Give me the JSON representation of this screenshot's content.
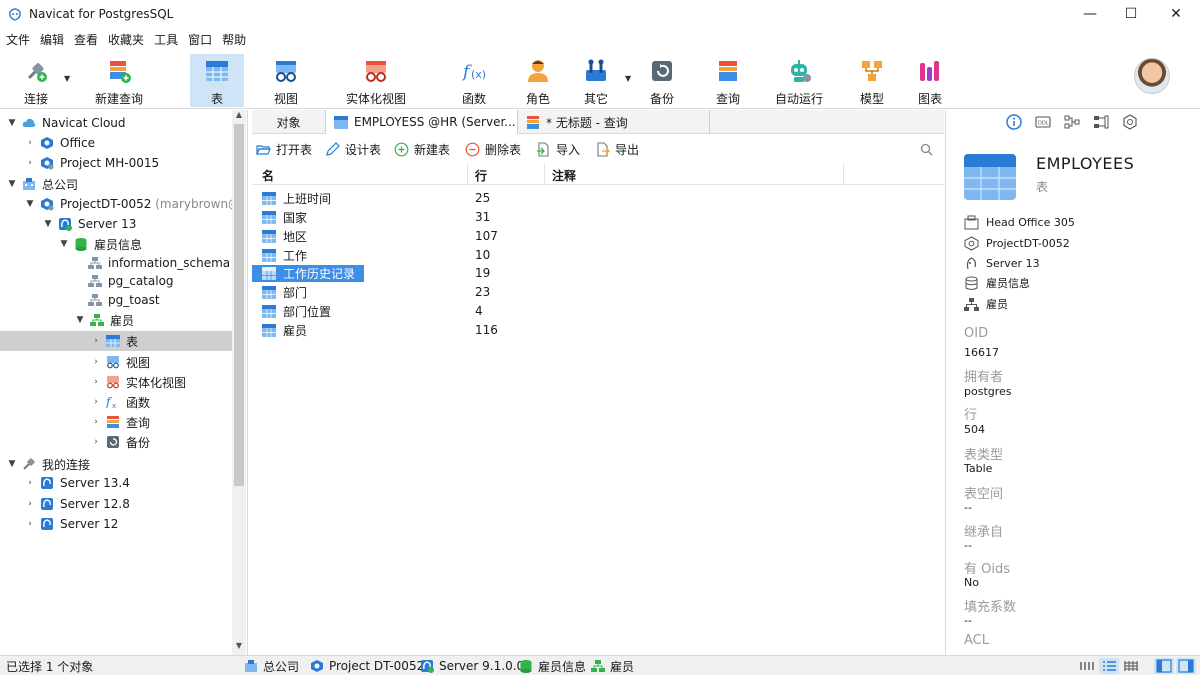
{
  "window": {
    "title": "Navicat for PostgresSQL",
    "minimize": "—",
    "maximize": "☐",
    "close": "✕"
  },
  "menu": [
    "文件",
    "编辑",
    "查看",
    "收藏夹",
    "工具",
    "窗口",
    "帮助"
  ],
  "toolbar": {
    "items": [
      {
        "label": "连接",
        "icon": "plug-icon"
      },
      {
        "label": "新建查询",
        "icon": "new-query-icon"
      },
      {
        "label": "表",
        "icon": "table-icon",
        "active": true
      },
      {
        "label": "视图",
        "icon": "view-icon"
      },
      {
        "label": "实体化视图",
        "icon": "materialized-view-icon"
      },
      {
        "label": "函数",
        "icon": "function-icon"
      },
      {
        "label": "角色",
        "icon": "role-icon"
      },
      {
        "label": "其它",
        "icon": "tools-icon"
      },
      {
        "label": "备份",
        "icon": "backup-icon"
      },
      {
        "label": "查询",
        "icon": "query-icon"
      },
      {
        "label": "自动运行",
        "icon": "robot-icon"
      },
      {
        "label": "模型",
        "icon": "model-icon"
      },
      {
        "label": "图表",
        "icon": "chart-icon"
      }
    ]
  },
  "tree": {
    "navicat_cloud": "Navicat Cloud",
    "office": "Office",
    "project_mh": "Project MH-0015",
    "head_company": "总公司",
    "project_dt": "ProjectDT-0052",
    "project_dt_user": "(marybrown@",
    "server13": "Server 13",
    "db_hr": "雇员信息",
    "schema_info": "information_schema",
    "schema_catalog": "pg_catalog",
    "schema_toast": "pg_toast",
    "schema_emp": "雇员",
    "node_tables": "表",
    "node_views": "视图",
    "node_matviews": "实体化视图",
    "node_functions": "函数",
    "node_queries": "查询",
    "node_backups": "备份",
    "my_connections": "我的连接",
    "server134": "Server 13.4",
    "server128": "Server 12.8",
    "server12": "Server 12"
  },
  "tabs": {
    "objects": "对象",
    "employees": "EMPLOYESS @HR (Server...",
    "untitled": "* 无标题 - 查询"
  },
  "object_toolbar": {
    "open": "打开表",
    "design": "设计表",
    "new": "新建表",
    "delete": "删除表",
    "import": "导入",
    "export": "导出"
  },
  "grid": {
    "columns": [
      "名",
      "行",
      "注释"
    ],
    "rows": [
      {
        "name": "上班时间",
        "rows": "25"
      },
      {
        "name": "国家",
        "rows": "31"
      },
      {
        "name": "地区",
        "rows": "107"
      },
      {
        "name": "工作",
        "rows": "10"
      },
      {
        "name": "工作历史记录",
        "rows": "19",
        "selected": true
      },
      {
        "name": "部门",
        "rows": "23"
      },
      {
        "name": "部门位置",
        "rows": "4"
      },
      {
        "name": "雇员",
        "rows": "116"
      }
    ]
  },
  "info": {
    "title": "EMPLOYEES",
    "subtitle": "表",
    "context": [
      "Head Office 305",
      "ProjectDT-0052",
      "Server 13",
      "雇员信息",
      "雇员"
    ],
    "props": [
      {
        "label": "OID",
        "value": "16617"
      },
      {
        "label": "拥有者",
        "value": "postgres"
      },
      {
        "label": "行",
        "value": "504"
      },
      {
        "label": "表类型",
        "value": "Table"
      },
      {
        "label": "表空间",
        "value": "--"
      },
      {
        "label": "继承自",
        "value": "--"
      },
      {
        "label": "有 Oids",
        "value": "No"
      },
      {
        "label": "填充系数",
        "value": "--"
      },
      {
        "label": "ACL",
        "value": ""
      }
    ]
  },
  "status": {
    "selected": "已选择 1 个对象",
    "crumb_company": "总公司",
    "crumb_project": "Project DT-0052",
    "crumb_server": "Server 9.1.0.0",
    "crumb_db": "雇员信息",
    "crumb_schema": "雇员"
  },
  "colors": {
    "accent": "#3c8ee6",
    "active_toolbar": "#cfe4f7",
    "tree_selected": "#cfcfcf"
  }
}
